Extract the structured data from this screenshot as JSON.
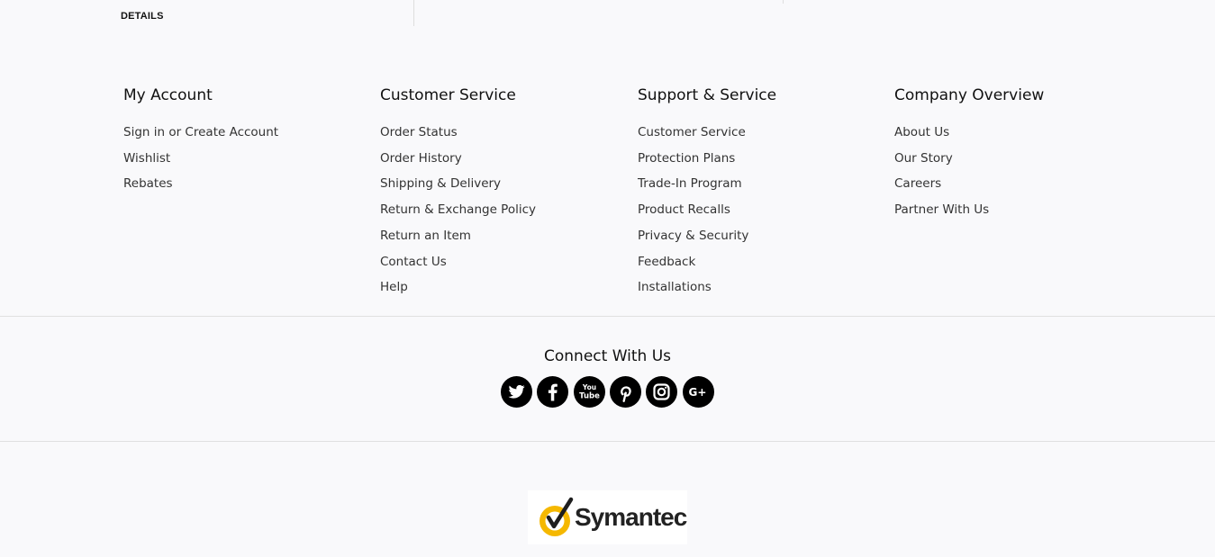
{
  "top": {
    "details_label": "DETAILS"
  },
  "columns": [
    {
      "heading": "My Account",
      "links": [
        "Sign in or Create Account",
        "Wishlist",
        "Rebates"
      ]
    },
    {
      "heading": "Customer Service",
      "links": [
        "Order Status",
        "Order History",
        "Shipping & Delivery",
        "Return & Exchange Policy",
        "Return an Item",
        "Contact Us",
        "Help"
      ]
    },
    {
      "heading": "Support & Service",
      "links": [
        "Customer Service",
        "Protection Plans",
        "Trade-In Program",
        "Product Recalls",
        "Privacy & Security",
        "Feedback",
        "Installations"
      ]
    },
    {
      "heading": "Company Overview",
      "links": [
        "About Us",
        "Our Story",
        "Careers",
        "Partner With Us"
      ]
    }
  ],
  "connect": {
    "title": "Connect With Us",
    "networks": [
      "twitter-icon",
      "facebook-icon",
      "youtube-icon",
      "pinterest-icon",
      "instagram-icon",
      "google-plus-icon"
    ]
  },
  "seal": {
    "brand": "Symantec",
    "check_color": "#f5b800"
  }
}
